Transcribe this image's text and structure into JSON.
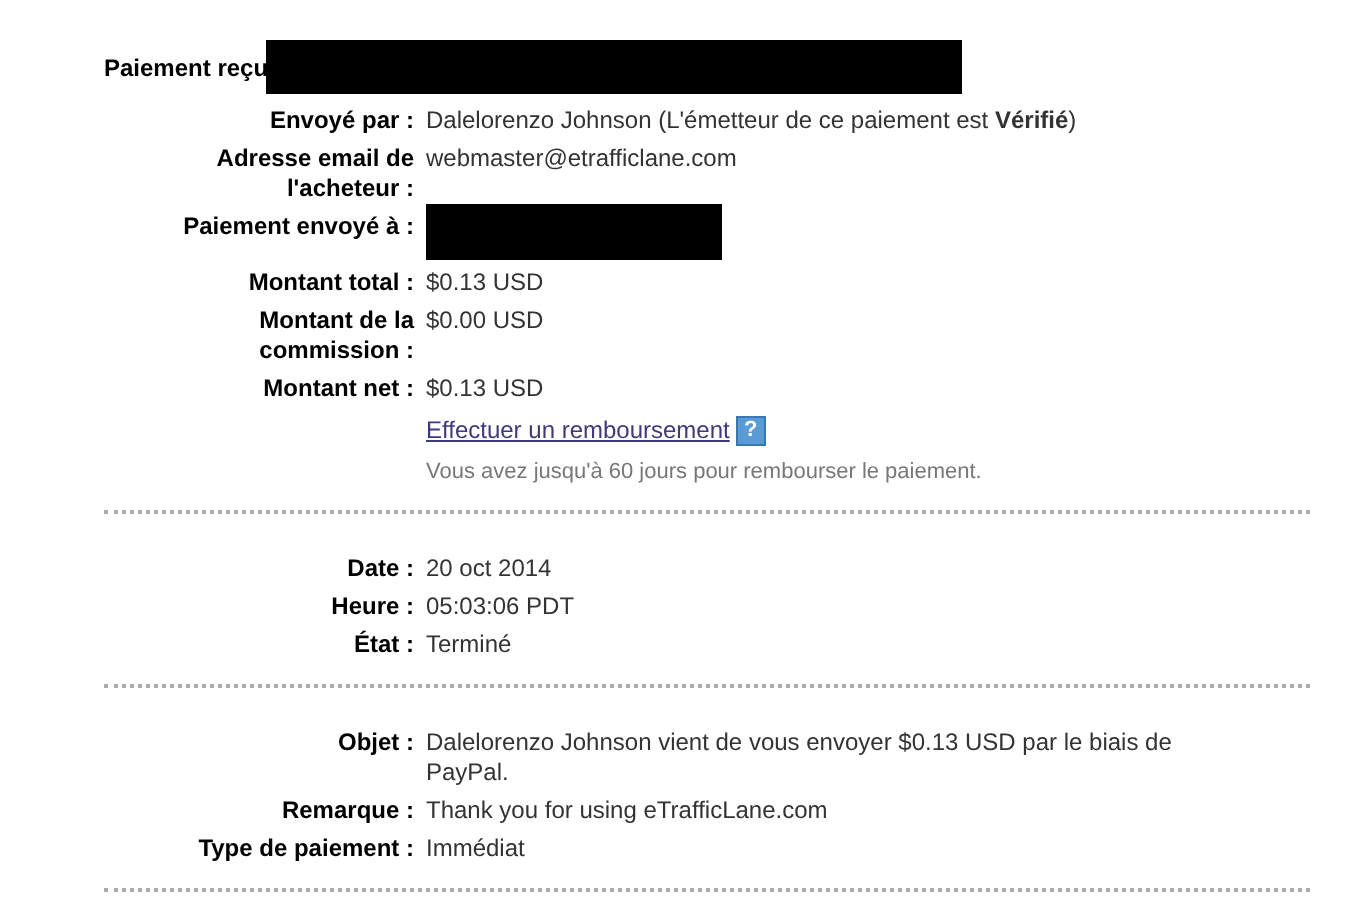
{
  "header": {
    "title": "Paiement reçu",
    "redacted": true
  },
  "sections": [
    {
      "rows": [
        {
          "kind": "text",
          "label": "Envoyé par :",
          "value": "Dalelorenzo Johnson (L'émetteur de ce paiement est **Vérifié**)"
        },
        {
          "kind": "text",
          "label": "Adresse email de l'acheteur :",
          "value": "webmaster@etrafficlane.com"
        },
        {
          "kind": "redacted",
          "label": "Paiement envoyé à :"
        },
        {
          "kind": "text",
          "label": "Montant total :",
          "value": "$0.13 USD"
        },
        {
          "kind": "text",
          "label": "Montant de la commission :",
          "value": "$0.00 USD"
        },
        {
          "kind": "text",
          "label": "Montant net :",
          "value": "$0.13 USD"
        },
        {
          "kind": "link",
          "value": "Effectuer un remboursement",
          "help": "?"
        },
        {
          "kind": "note",
          "value": "Vous avez jusqu'à 60 jours pour rembourser le paiement."
        }
      ]
    },
    {
      "rows": [
        {
          "kind": "text",
          "label": "Date :",
          "value": "20 oct 2014"
        },
        {
          "kind": "text",
          "label": "Heure :",
          "value": "05:03:06 PDT"
        },
        {
          "kind": "text",
          "label": "État :",
          "value": "Terminé"
        }
      ]
    },
    {
      "rows": [
        {
          "kind": "text",
          "label": "Objet :",
          "value": "Dalelorenzo Johnson vient de vous envoyer $0.13 USD par le biais de PayPal."
        },
        {
          "kind": "text",
          "label": "Remarque :",
          "value": "Thank you for using eTrafficLane.com"
        },
        {
          "kind": "text",
          "label": "Type de paiement :",
          "value": "Immédiat"
        }
      ]
    }
  ]
}
